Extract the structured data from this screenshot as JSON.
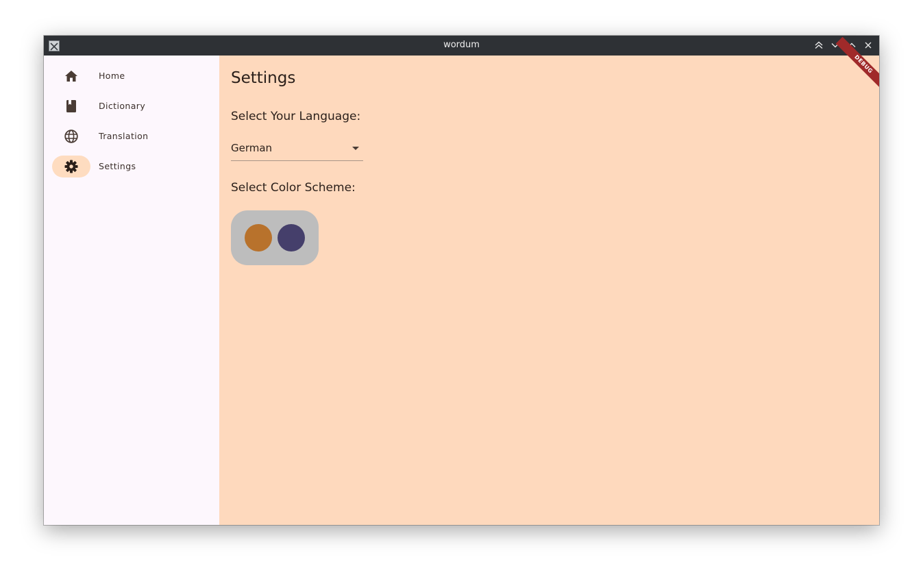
{
  "window": {
    "title": "wordum",
    "controls": [
      "keep-above-icon",
      "minimize-icon",
      "maximize-icon",
      "close-icon"
    ]
  },
  "sidebar": {
    "items": [
      {
        "label": "Home",
        "icon": "home-icon",
        "selected": false
      },
      {
        "label": "Dictionary",
        "icon": "book-icon",
        "selected": false
      },
      {
        "label": "Translation",
        "icon": "globe-icon",
        "selected": false
      },
      {
        "label": "Settings",
        "icon": "gear-icon",
        "selected": true
      }
    ]
  },
  "settings": {
    "title": "Settings",
    "language_label": "Select Your Language:",
    "language_value": "German",
    "color_scheme_label": "Select Color Scheme:",
    "color_schemes": [
      {
        "name": "orange",
        "color": "#b8722c"
      },
      {
        "name": "indigo",
        "color": "#453f6b"
      }
    ]
  },
  "debug_banner": "DEBUG",
  "colors": {
    "accent": "#fedcc0",
    "content_background": "#fed9bd",
    "sidebar_background": "#fdf7fd",
    "titlebar": "#2e3135",
    "icon": "#4a3c35"
  }
}
